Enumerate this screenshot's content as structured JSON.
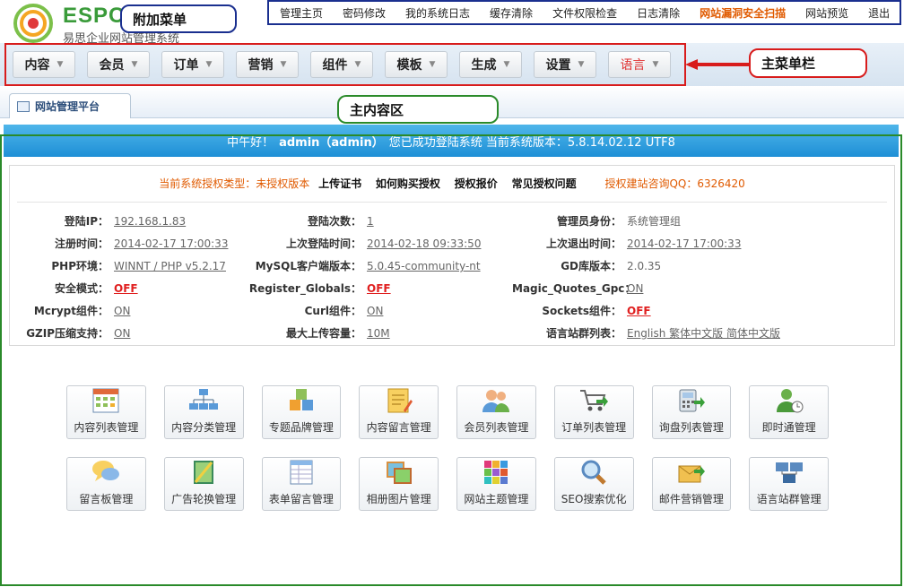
{
  "logo": {
    "brand": "ESPC",
    "subtitle": "易思企业网站管理系统"
  },
  "top_menu": {
    "items": [
      "管理主页",
      "密码修改",
      "我的系统日志",
      "缓存清除",
      "文件权限检查",
      "日志清除",
      "网站漏洞安全扫描",
      "网站预览",
      "退出"
    ],
    "highlight_color": "#e05a00"
  },
  "callouts": {
    "top_menu": "附加菜单",
    "main_menu": "主菜单栏",
    "content_area": "主内容区"
  },
  "main_menu": {
    "items": [
      "内容",
      "会员",
      "订单",
      "营销",
      "组件",
      "模板",
      "生成",
      "设置",
      "语言"
    ],
    "dropdown_glyph": "▼"
  },
  "tab": {
    "label": "网站管理平台"
  },
  "welcome": {
    "prefix": "中午好！",
    "user": "admin（admin）",
    "message": "您已成功登陆系统  当前系统版本：5.8.14.02.12 UTF8"
  },
  "license": {
    "type_text": "当前系统授权类型：未授权版本",
    "links": [
      "上传证书",
      "如何购买授权",
      "授权报价",
      "常见授权问题"
    ],
    "qq_text": "授权建站咨询QQ：6326420"
  },
  "info": {
    "rows": [
      [
        {
          "label": "登陆IP：",
          "value": "192.168.1.83"
        },
        {
          "label": "登陆次数：",
          "value": "1"
        },
        {
          "label": "管理员身份：",
          "value": "系统管理组"
        }
      ],
      [
        {
          "label": "注册时间：",
          "value": "2014-02-17 17:00:33"
        },
        {
          "label": "上次登陆时间：",
          "value": "2014-02-18 09:33:50"
        },
        {
          "label": "上次退出时间：",
          "value": "2014-02-17 17:00:33"
        }
      ],
      [
        {
          "label": "PHP环境：",
          "value": "WINNT / PHP v5.2.17"
        },
        {
          "label": "MySQL客户端版本：",
          "value": "5.0.45-community-nt"
        },
        {
          "label": "GD库版本：",
          "value": "2.0.35"
        }
      ],
      [
        {
          "label": "安全模式：",
          "value": "OFF"
        },
        {
          "label": "Register_Globals：",
          "value": "OFF"
        },
        {
          "label": "Magic_Quotes_Gpc：",
          "value": "ON"
        }
      ],
      [
        {
          "label": "Mcrypt组件：",
          "value": "ON"
        },
        {
          "label": "Curl组件：",
          "value": "ON"
        },
        {
          "label": "Sockets组件：",
          "value": "OFF"
        }
      ],
      [
        {
          "label": "GZIP压缩支持：",
          "value": "ON"
        },
        {
          "label": "最大上传容量：",
          "value": "10M"
        },
        {
          "label": "语言站群列表：",
          "value": "English 繁体中文版 简体中文版"
        }
      ]
    ]
  },
  "modules": {
    "row1": [
      {
        "label": "内容列表管理",
        "icon": "calendar-grid-icon"
      },
      {
        "label": "内容分类管理",
        "icon": "tree-hierarchy-icon"
      },
      {
        "label": "专题品牌管理",
        "icon": "cubes-icon"
      },
      {
        "label": "内容留言管理",
        "icon": "note-pencil-icon"
      },
      {
        "label": "会员列表管理",
        "icon": "users-icon"
      },
      {
        "label": "订单列表管理",
        "icon": "shopping-cart-icon"
      },
      {
        "label": "询盘列表管理",
        "icon": "phone-icon"
      },
      {
        "label": "即时通管理",
        "icon": "user-clock-icon"
      }
    ],
    "row2": [
      {
        "label": "留言板管理",
        "icon": "speech-bubbles-icon"
      },
      {
        "label": "广告轮换管理",
        "icon": "ad-image-icon"
      },
      {
        "label": "表单留言管理",
        "icon": "form-table-icon"
      },
      {
        "label": "相册图片管理",
        "icon": "photo-album-icon"
      },
      {
        "label": "网站主题管理",
        "icon": "color-tiles-icon"
      },
      {
        "label": "SEO搜索优化",
        "icon": "magnifier-icon"
      },
      {
        "label": "邮件营销管理",
        "icon": "mail-box-icon"
      },
      {
        "label": "语言站群管理",
        "icon": "network-computers-icon"
      }
    ]
  }
}
